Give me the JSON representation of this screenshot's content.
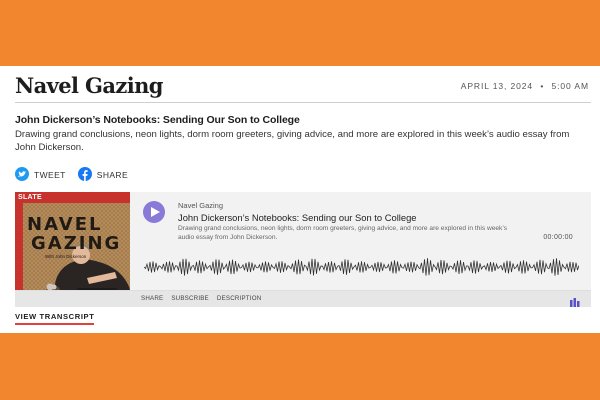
{
  "colors": {
    "background": "#f2862f",
    "card": "#ffffff",
    "play_button": "#8a7ad8",
    "twitter_blue": "#1d9bf0",
    "facebook_blue": "#1877f2",
    "transcript_underline": "#e0413a",
    "art_brown": "#b08a5a",
    "art_red": "#c8322d"
  },
  "header": {
    "brand": "Navel Gazing",
    "date": "APRIL 13, 2024",
    "separator": "•",
    "time": "5:00 AM"
  },
  "article": {
    "headline": "John Dickerson’s Notebooks: Sending Our Son to College",
    "dek": "Drawing grand conclusions, neon lights, dorm room greeters, giving advice, and more are explored in this week’s audio essay from John Dickerson."
  },
  "share": {
    "tweet_label": "TWEET",
    "tweet_icon": "twitter-bird-icon",
    "share_label": "SHARE",
    "share_icon": "facebook-icon"
  },
  "player": {
    "art": {
      "badge": "SLATE",
      "title_line1": "NAVEL",
      "title_line2": "GAZING",
      "byline": "With John Dickerson"
    },
    "show_name": "Navel Gazing",
    "episode_title": "John Dickerson’s Notebooks: Sending our Son to College",
    "episode_desc": "Drawing grand conclusions, neon lights, dorm room greeters, giving advice, and more are explored in this week’s audio essay from John Dickerson.",
    "time": "00:00:00",
    "play_icon": "play-icon",
    "footer_links": [
      "SHARE",
      "SUBSCRIBE",
      "DESCRIPTION"
    ],
    "brand_icon": "bars-logo-icon"
  },
  "transcript_link": "VIEW TRANSCRIPT"
}
